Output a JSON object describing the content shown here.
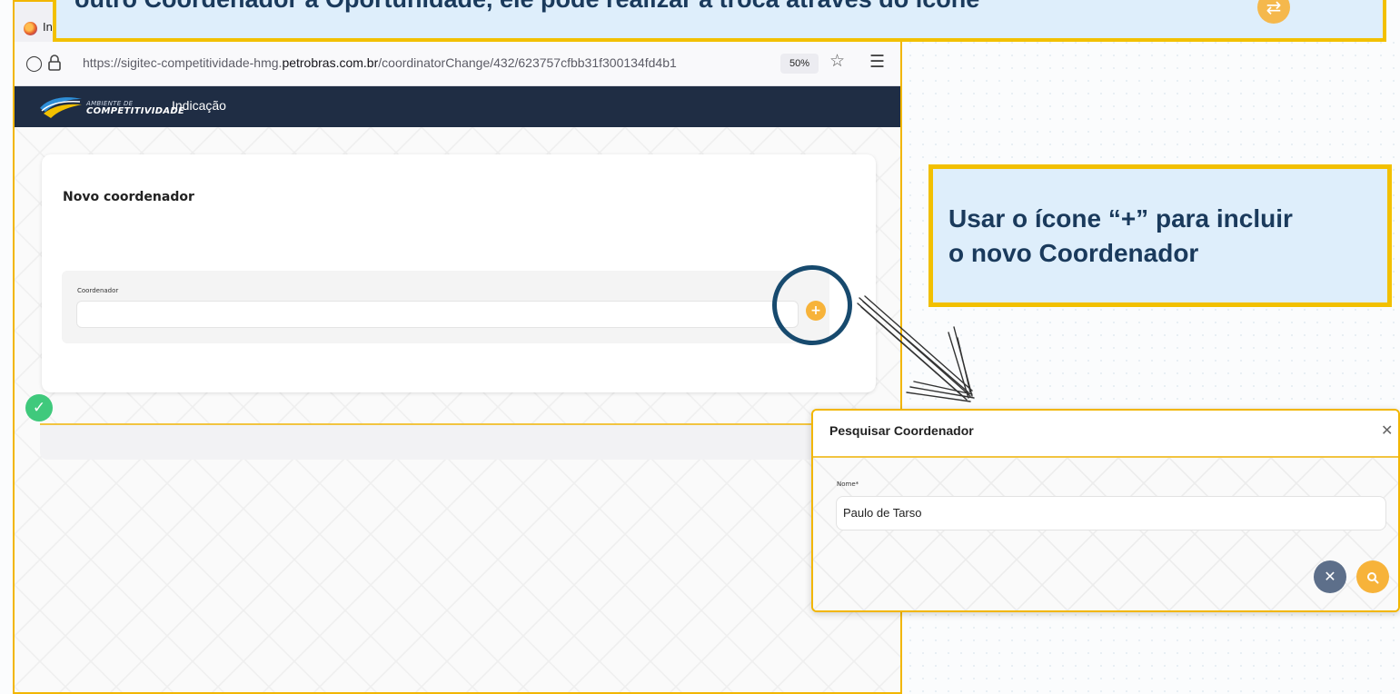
{
  "browser": {
    "tab_title": "In",
    "url_prefix": "https://sigitec-competitividade-hmg.",
    "url_domain": "petrobras.com.br",
    "url_path": "/coordinatorChange/432/623757cfbb31f300134fd4b1",
    "zoom": "50%"
  },
  "app": {
    "logo_line1": "AMBIENTE DE",
    "logo_line2": "COMPETITIVIDADE",
    "nav_link": "Indicação"
  },
  "card": {
    "title": "Novo coordenador",
    "field_label": "Coordenador",
    "field_value": "",
    "add_symbol": "+"
  },
  "callouts": {
    "top_text": "outro Coordenador a Oportunidade, ele pode realizar a troca através do ícone",
    "side_line1": "Usar o ícone “+” para incluir",
    "side_line2": "o novo Coordenador"
  },
  "dialog": {
    "title": "Pesquisar Coordenador",
    "field_label": "Nome*",
    "field_value": "Paulo de Tarso"
  },
  "icons": {
    "tab_favicon": "firefox-icon",
    "shield": "shield-icon",
    "lock": "lock-icon",
    "star": "star-icon",
    "menu": "hamburger-menu-icon",
    "check": "check-icon",
    "close": "close-icon",
    "search": "search-icon"
  },
  "colors": {
    "accent_yellow": "#f2c000",
    "nav_navy": "#1f2d44",
    "callout_blue": "#deeefb",
    "button_orange": "#f7b33a",
    "button_slate": "#5d6f8a",
    "success_green": "#3fc97c",
    "ring_navy": "#174a6e"
  }
}
